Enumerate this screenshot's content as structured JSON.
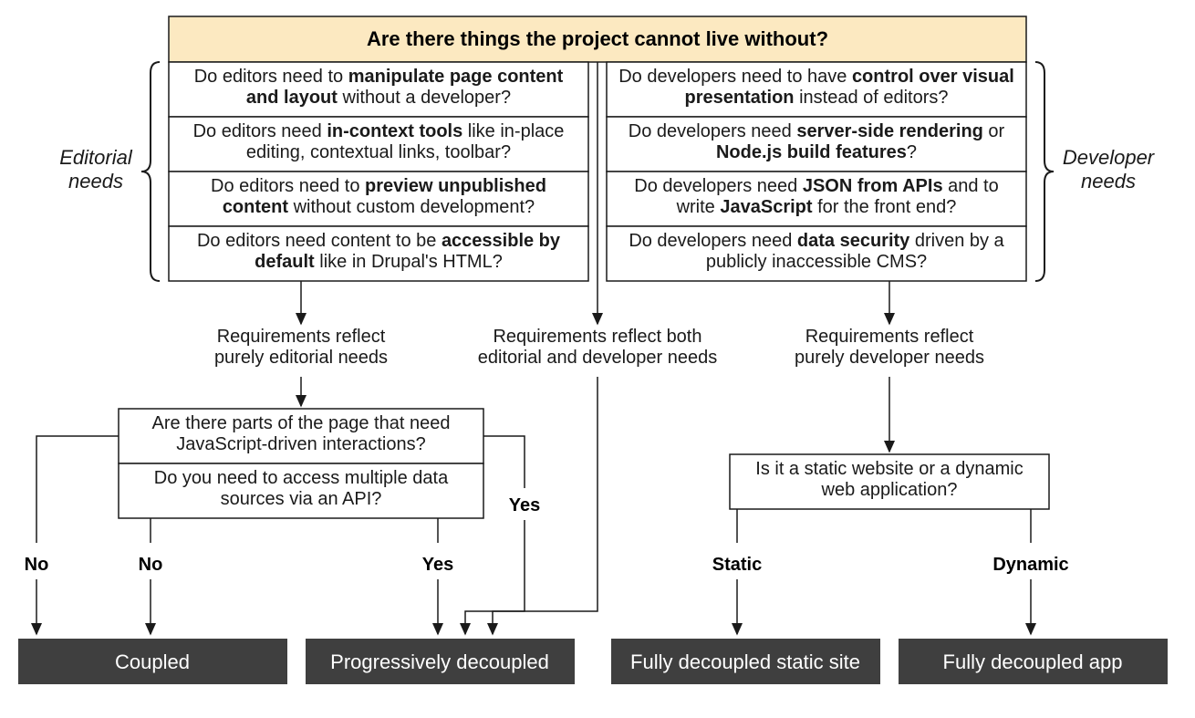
{
  "title": "Are there things the project cannot live without?",
  "brace_left": "Editorial needs",
  "brace_right": "Developer needs",
  "editorial": [
    "Do editors need to <b>manipulate page content and layout</b> without a developer?",
    "Do editors need <b>in-context tools</b> like in-place editing, contextual links, toolbar?",
    "Do editors need to <b>preview unpublished content</b> without custom development?",
    "Do editors need content to be <b>accessible by default</b> like in Drupal's HTML?"
  ],
  "developer": [
    "Do developers need to have <b>control over visual presentation</b> instead of editors?",
    "Do developers need <b>server-side rendering</b> or <b>Node.js build features</b>?",
    "Do developers need <b>JSON from APIs</b> and to write <b>JavaScript</b> for the front end?",
    "Do developers need <b>data security</b> driven by a publicly inaccessible CMS?"
  ],
  "branch_left": "Requirements reflect purely editorial needs",
  "branch_mid": "Requirements reflect both editorial and developer needs",
  "branch_right": "Requirements reflect purely developer needs",
  "q_left_a": "Are there parts of the page that need JavaScript-driven interactions?",
  "q_left_b": "Do you need to access multiple data sources via an API?",
  "q_right": "Is it a static website or a dynamic web application?",
  "ans_no": "No",
  "ans_yes": "Yes",
  "ans_static": "Static",
  "ans_dynamic": "Dynamic",
  "result_coupled": "Coupled",
  "result_progressive": "Progressively decoupled",
  "result_static": "Fully decoupled static site",
  "result_app": "Fully decoupled app"
}
